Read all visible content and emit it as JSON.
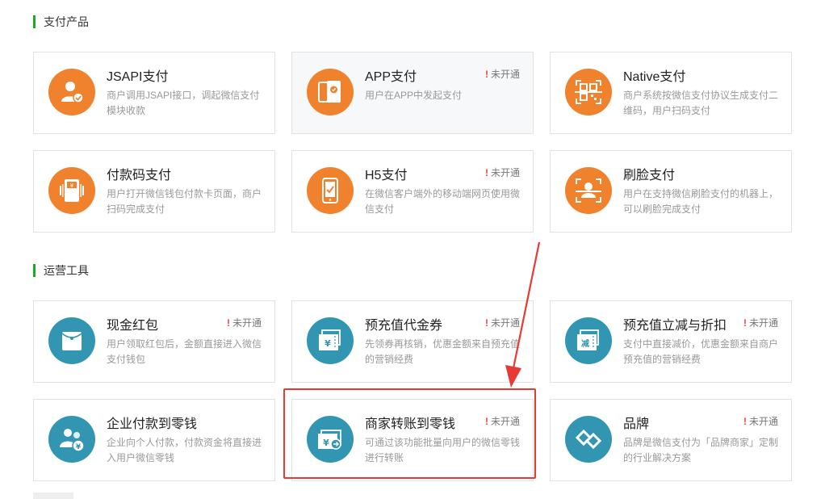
{
  "sections": {
    "payment": {
      "title": "支付产品"
    },
    "operations": {
      "title": "运营工具"
    }
  },
  "status_label": "未开通",
  "status_mark": "!",
  "colors": {
    "orange": "#f0822d",
    "teal": "#3296b2",
    "status_red": "#e64340",
    "highlight": "#e83a35",
    "accent_green": "#1aad19"
  },
  "cards": {
    "jsapi": {
      "name": "JSAPI支付",
      "desc": "商户调用JSAPI接口，调起微信支付模块收款",
      "icon": "person-check-icon"
    },
    "app": {
      "name": "APP支付",
      "desc": "用户在APP中发起支付",
      "icon": "app-phone-icon"
    },
    "native": {
      "name": "Native支付",
      "desc": "商户系统按微信支付协议生成支付二维码，用户扫码支付",
      "icon": "qrcode-icon"
    },
    "paycode": {
      "name": "付款码支付",
      "desc": "用户打开微信钱包付款卡页面，商户扫码完成支付",
      "icon": "scanner-icon"
    },
    "h5": {
      "name": "H5支付",
      "desc": "在微信客户端外的移动端网页使用微信支付",
      "icon": "mobile-check-icon"
    },
    "face": {
      "name": "刷脸支付",
      "desc": "用户在支持微信刷脸支付的机器上，可以刷脸完成支付",
      "icon": "face-scan-icon"
    },
    "red_packet": {
      "name": "现金红包",
      "desc": "用户领取红包后，金额直接进入微信支付钱包",
      "icon": "red-packet-icon"
    },
    "voucher": {
      "name": "预充值代金券",
      "desc": "先领券再核销，优惠金额来自预充值的营销经费",
      "icon": "voucher-icon"
    },
    "discount": {
      "name": "预充值立减与折扣",
      "desc": "支付中直接减价，优惠金额来自商户预充值的营销经费",
      "icon": "discount-icon",
      "icon_text": "减"
    },
    "enterprise": {
      "name": "企业付款到零钱",
      "desc": "企业向个人付款，付款资金将直接进入用户微信零钱",
      "icon": "enterprise-pay-icon"
    },
    "transfer": {
      "name": "商家转账到零钱",
      "desc": "可通过该功能批量向用户的微信零钱进行转账",
      "icon": "transfer-icon"
    },
    "brand": {
      "name": "品牌",
      "desc": "品牌是微信支付为「品牌商家」定制的行业解决方案",
      "icon": "brand-icon"
    }
  }
}
